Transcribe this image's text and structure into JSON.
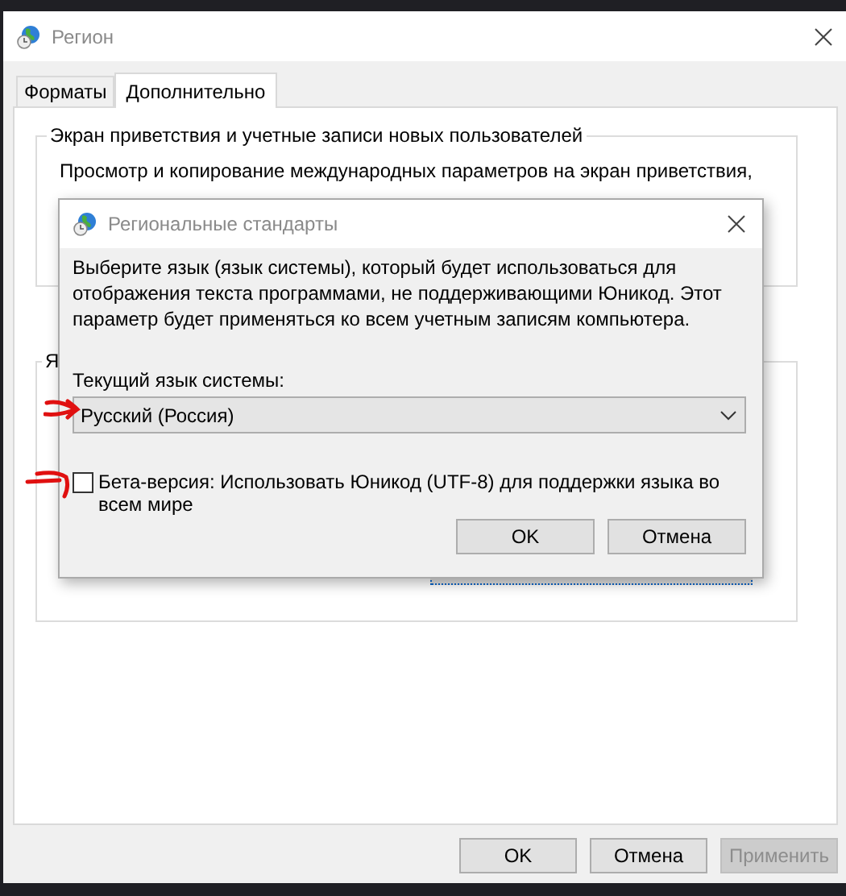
{
  "window": {
    "title": "Регион"
  },
  "tabs": [
    {
      "label": "Форматы",
      "selected": false
    },
    {
      "label": "Дополнительно",
      "selected": true
    }
  ],
  "groups": [
    {
      "legend": "Экран приветствия и учетные записи новых пользователей",
      "text": "Просмотр и копирование международных параметров на экран приветствия,"
    },
    {
      "legend": "Я"
    }
  ],
  "dialog": {
    "title": "Региональные стандарты",
    "description": "Выберите язык (язык системы), который будет использоваться для отображения текста программами, не поддерживающими Юникод. Этот параметр будет применяться ко всем учетным записям компьютера.",
    "field_label": "Текущий язык системы:",
    "system_language": "Русский (Россия)",
    "beta_option": {
      "label": "Бета-версия: Использовать Юникод (UTF-8) для поддержки языка во всем мире",
      "checked": false
    },
    "buttons": [
      "OK",
      "Отмена"
    ]
  },
  "buttons": [
    {
      "label": "OK",
      "disabled": false
    },
    {
      "label": "Отмена",
      "disabled": false
    },
    {
      "label": "Применить",
      "disabled": true
    }
  ]
}
